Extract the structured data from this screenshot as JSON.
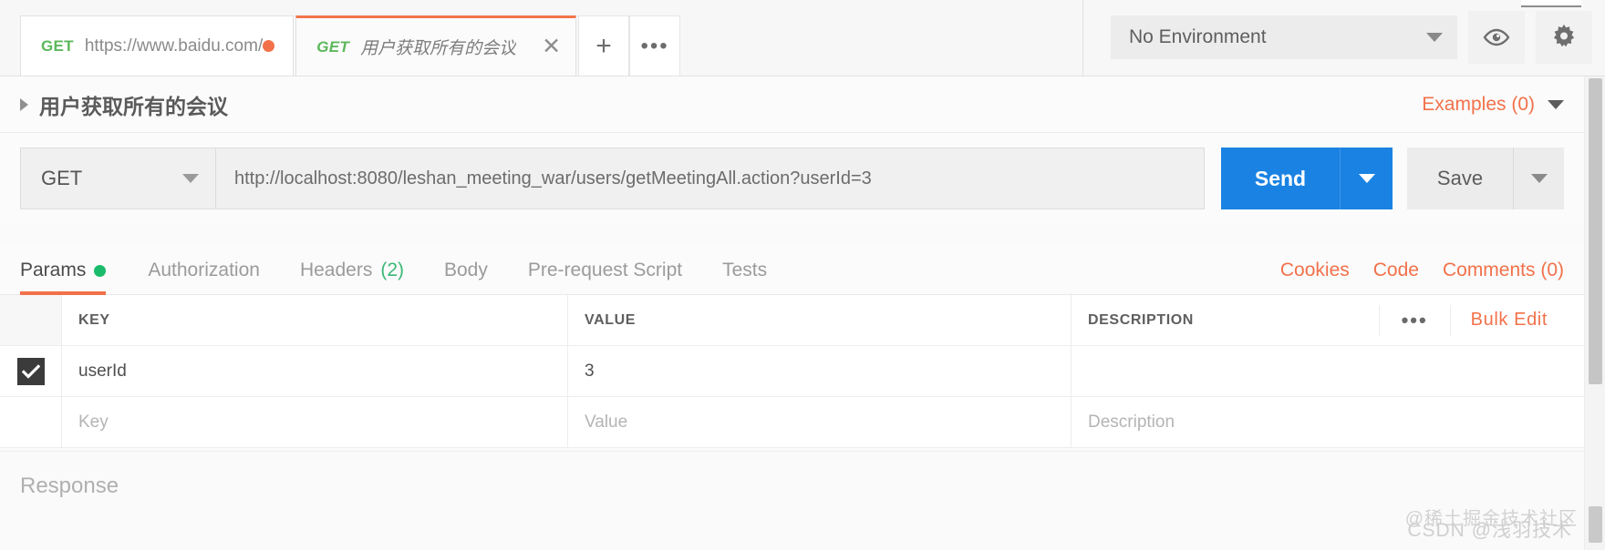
{
  "tabs": [
    {
      "method": "GET",
      "title": "https://www.baidu.com/",
      "state": "unsaved",
      "active": false
    },
    {
      "method": "GET",
      "title": "用户获取所有的会议",
      "state": "open",
      "active": true
    }
  ],
  "tabbar": {
    "new_tab_label": "+",
    "more_label": "•••",
    "close_label": "✕"
  },
  "environment": {
    "selected": "No Environment",
    "eye_icon": "eye-icon",
    "gear_icon": "gear-icon"
  },
  "request": {
    "name": "用户获取所有的会议",
    "examples_label": "Examples (0)",
    "method": "GET",
    "url": "http://localhost:8080/leshan_meeting_war/users/getMeetingAll.action?userId=3",
    "send_label": "Send",
    "save_label": "Save"
  },
  "inner_tabs": [
    {
      "label": "Params",
      "badge": "",
      "dot": true,
      "active": true
    },
    {
      "label": "Authorization",
      "badge": "",
      "dot": false,
      "active": false
    },
    {
      "label": "Headers",
      "badge": "(2)",
      "dot": false,
      "active": false
    },
    {
      "label": "Body",
      "badge": "",
      "dot": false,
      "active": false
    },
    {
      "label": "Pre-request Script",
      "badge": "",
      "dot": false,
      "active": false
    },
    {
      "label": "Tests",
      "badge": "",
      "dot": false,
      "active": false
    }
  ],
  "inner_tabs_right": [
    {
      "label": "Cookies"
    },
    {
      "label": "Code"
    },
    {
      "label": "Comments (0)"
    }
  ],
  "params_table": {
    "columns": [
      "KEY",
      "VALUE",
      "DESCRIPTION"
    ],
    "dots_label": "•••",
    "bulk_edit_label": "Bulk Edit",
    "rows": [
      {
        "checked": true,
        "key": "userId",
        "value": "3",
        "description": ""
      }
    ],
    "placeholders": {
      "key": "Key",
      "value": "Value",
      "description": "Description"
    }
  },
  "response": {
    "label": "Response"
  },
  "watermarks": {
    "line1": "@稀土掘金技术社区",
    "line2": "CSDN @浅羽技术"
  },
  "colors": {
    "accent_orange": "#f2714a",
    "send_blue": "#1a82e2",
    "method_green": "#5cb85c",
    "dot_green": "#1abc6b"
  }
}
